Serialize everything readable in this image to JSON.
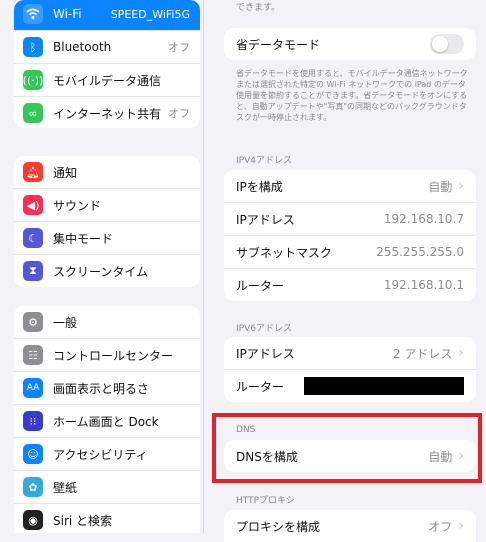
{
  "sidebar": {
    "group1": [
      {
        "label": "Wi-Fi",
        "value": "SPEED_WiFi5G",
        "icon": "wifi-icon",
        "color": "#0a84ff",
        "selected": true
      },
      {
        "label": "Bluetooth",
        "value": "オフ",
        "icon": "bluetooth-icon",
        "color": "#0a84ff"
      },
      {
        "label": "モバイルデータ通信",
        "value": "",
        "icon": "antenna-icon",
        "color": "#34c759"
      },
      {
        "label": "インターネット共有",
        "value": "オフ",
        "icon": "link-icon",
        "color": "#34c759"
      }
    ],
    "group2": [
      {
        "label": "通知",
        "icon": "bell-icon",
        "color": "#ff3b30"
      },
      {
        "label": "サウンド",
        "icon": "speaker-icon",
        "color": "#ff2d55"
      },
      {
        "label": "集中モード",
        "icon": "moon-icon",
        "color": "#5856d6"
      },
      {
        "label": "スクリーンタイム",
        "icon": "hourglass-icon",
        "color": "#5856d6"
      }
    ],
    "group3": [
      {
        "label": "一般",
        "icon": "gear-icon",
        "color": "#8e8e93"
      },
      {
        "label": "コントロールセンター",
        "icon": "switches-icon",
        "color": "#8e8e93"
      },
      {
        "label": "画面表示と明るさ",
        "icon": "aa-icon",
        "color": "#0a84ff"
      },
      {
        "label": "ホーム画面と Dock",
        "icon": "grid-icon",
        "color": "#3a3ad0"
      },
      {
        "label": "アクセシビリティ",
        "icon": "accessibility-icon",
        "color": "#0a84ff"
      },
      {
        "label": "壁紙",
        "icon": "flower-icon",
        "color": "#34aadc"
      },
      {
        "label": "Siri と検索",
        "icon": "siri-icon",
        "color": "#222222"
      }
    ]
  },
  "detail": {
    "top_caption": "できます。",
    "low_data": {
      "label": "省データモード",
      "on": false
    },
    "low_data_desc": "省データモードを使用すると、モバイルデータ通信ネットワークまたは選択された特定の Wi-Fi ネットワークでの iPad のデータ使用量を節約することができます。省データモードをオンにすると、自動アップデートや\"写真\"の同期などのバックグラウンドタスクが一時停止されます。",
    "ipv4_header": "IPV4アドレス",
    "ipv4_rows": [
      {
        "label": "IPを構成",
        "value": "自動",
        "chevron": true
      },
      {
        "label": "IPアドレス",
        "value": "192.168.10.7"
      },
      {
        "label": "サブネットマスク",
        "value": "255.255.255.0"
      },
      {
        "label": "ルーター",
        "value": "192.168.10.1"
      }
    ],
    "ipv6_header": "IPV6アドレス",
    "ipv6_rows": [
      {
        "label": "IPアドレス",
        "value": "2 アドレス",
        "chevron": true
      },
      {
        "label": "ルーター",
        "value": "",
        "redacted": true
      }
    ],
    "dns_header": "DNS",
    "dns_row": {
      "label": "DNSを構成",
      "value": "自動"
    },
    "http_header": "HTTPプロキシ",
    "proxy_row": {
      "label": "プロキシを構成",
      "value": "オフ"
    },
    "highlight_color": "#e0232b"
  }
}
